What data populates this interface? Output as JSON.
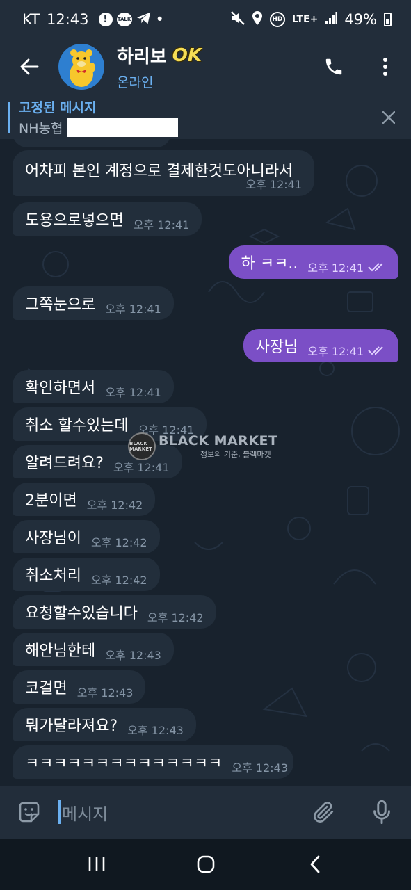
{
  "status_bar": {
    "carrier": "KT",
    "time": "12:43",
    "notif_alert": "!",
    "notif_talk": "TALK",
    "notif_dot": "•",
    "hd": "HD",
    "network": "LTE+",
    "battery": "49%"
  },
  "header": {
    "title": "하리보",
    "badge": "OK",
    "status": "온라인"
  },
  "pinned": {
    "title": "고정된 메시지",
    "preview": "NH농협"
  },
  "messages": [
    {
      "text": "어차피 본인 계정으로 결제한것도아니라서",
      "time": "오후 12:41",
      "dir": "in"
    },
    {
      "text": "도용으로넣으면",
      "time": "오후 12:41",
      "dir": "in"
    },
    {
      "text": "하 ㅋㅋ..",
      "time": "오후 12:41",
      "dir": "out"
    },
    {
      "text": "그쪽눈으로",
      "time": "오후 12:41",
      "dir": "in"
    },
    {
      "text": "사장님",
      "time": "오후 12:41",
      "dir": "out"
    },
    {
      "text": "확인하면서",
      "time": "오후 12:41",
      "dir": "in"
    },
    {
      "text": "취소 할수있는데",
      "time": "오후 12:41",
      "dir": "in"
    },
    {
      "text": "알려드려요?",
      "time": "오후 12:41",
      "dir": "in"
    },
    {
      "text": "2분이면",
      "time": "오후 12:42",
      "dir": "in"
    },
    {
      "text": "사장님이",
      "time": "오후 12:42",
      "dir": "in"
    },
    {
      "text": "취소처리",
      "time": "오후 12:42",
      "dir": "in"
    },
    {
      "text": "요청할수있습니다",
      "time": "오후 12:42",
      "dir": "in"
    },
    {
      "text": "해안님한테",
      "time": "오후 12:43",
      "dir": "in"
    },
    {
      "text": "코걸면",
      "time": "오후 12:43",
      "dir": "in"
    },
    {
      "text": "뭐가달라져요?",
      "time": "오후 12:43",
      "dir": "in"
    },
    {
      "text": "ㅋㅋㅋㅋㅋㅋㅋㅋㅋㅋㅋㅋㅋㅋ",
      "time": "오후 12:43",
      "dir": "in"
    }
  ],
  "watermark": {
    "logo_text": "BLACK MARKET",
    "title": "BLACK MARKET",
    "subtitle": "정보의 기준, 블랙마켓"
  },
  "input": {
    "placeholder": "메시지"
  },
  "colors": {
    "accent": "#6bb0f0",
    "outgoing_bubble": "#7b4fc6",
    "incoming_bubble": "#222e3b",
    "chat_background": "#18222d"
  }
}
